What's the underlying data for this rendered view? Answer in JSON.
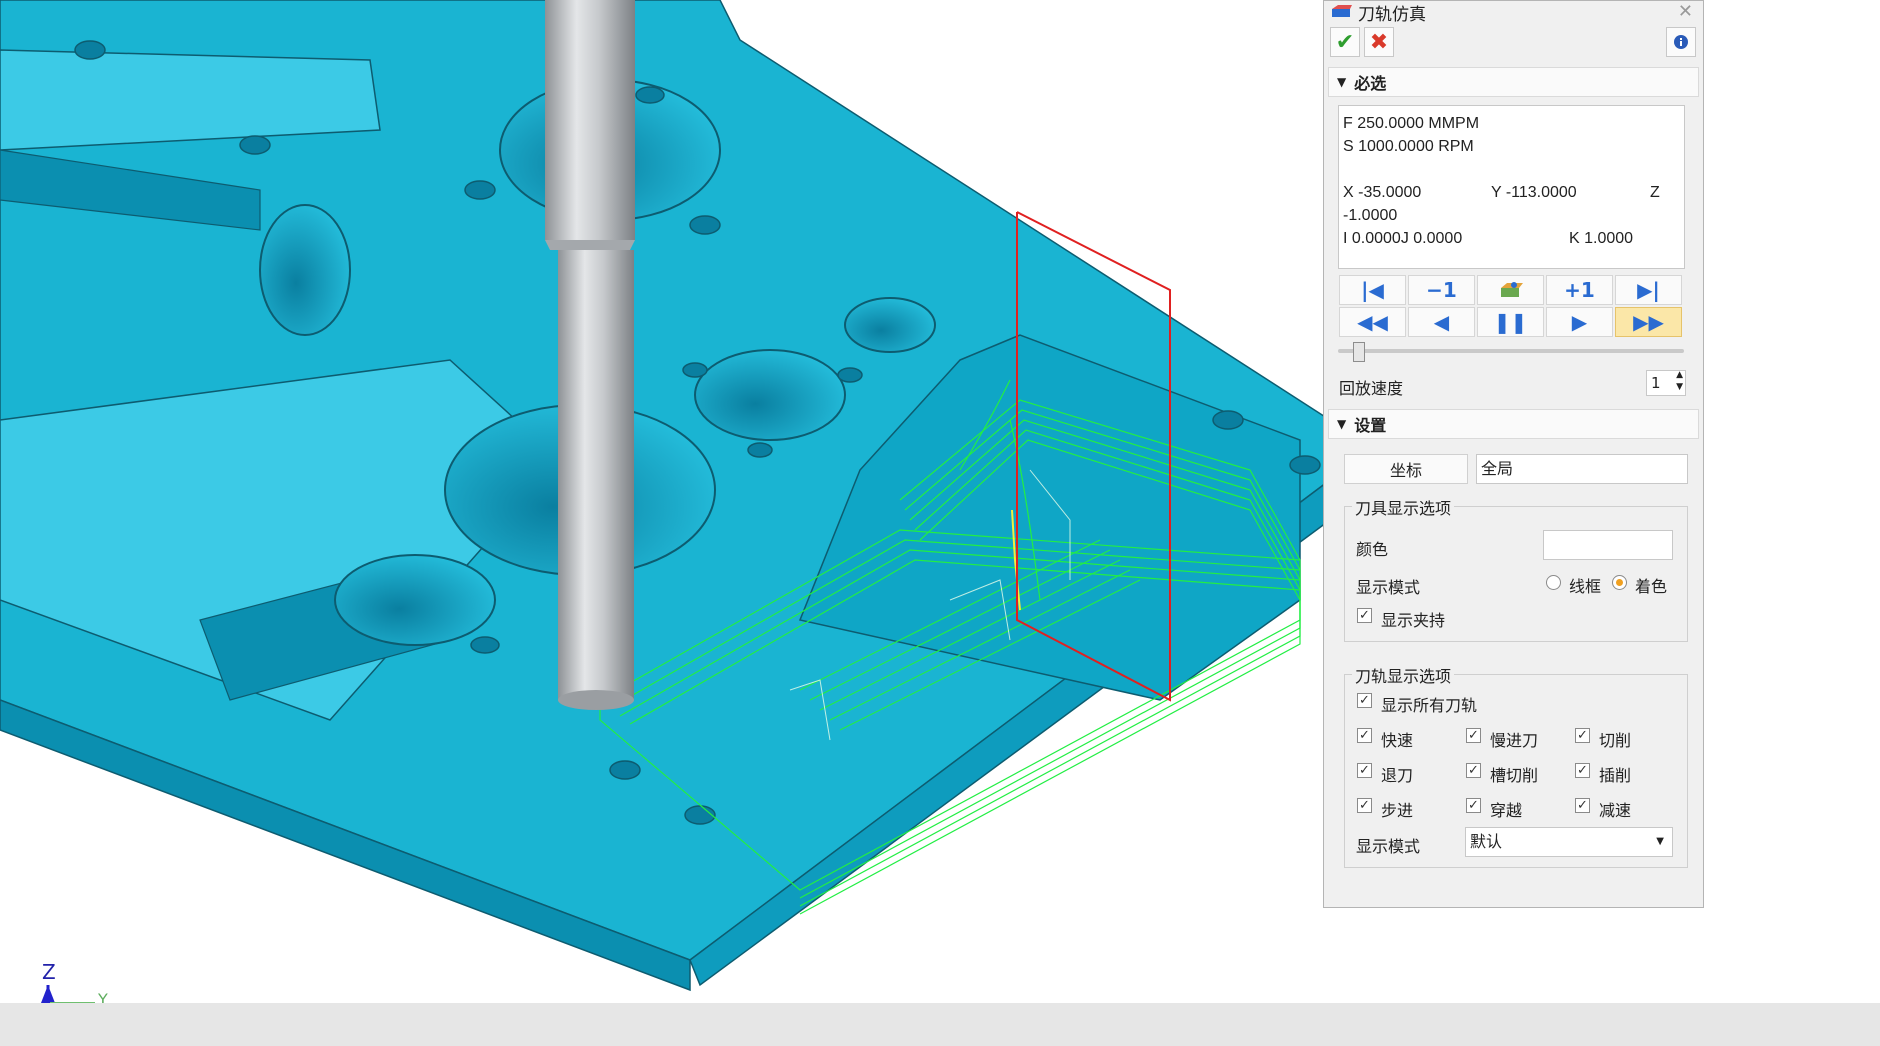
{
  "window": {
    "title": "刀轨仿真",
    "icon": "toolpath-sim-icon",
    "close_icon": "close-icon"
  },
  "actions": {
    "ok_icon": "check-icon",
    "cancel_icon": "x-icon",
    "info_icon": "info-icon",
    "ok_color": "#2e9d2e",
    "cancel_color": "#d93a2b"
  },
  "required_section": {
    "title": "必选",
    "readout": {
      "f": "F  250.0000 MMPM",
      "s": "S 1000.0000 RPM",
      "x": "X  -35.0000",
      "y": "Y -113.0000",
      "z_label": "Z",
      "z_value": "-1.0000",
      "i": "I    0.0000J    0.0000",
      "k": "K    1.0000"
    },
    "toolbar_row1": [
      {
        "name": "go-to-start",
        "label": "|◀"
      },
      {
        "name": "step-back",
        "label": "−1"
      },
      {
        "name": "show-material",
        "label": ""
      },
      {
        "name": "step-forward",
        "label": "+1"
      },
      {
        "name": "go-to-end",
        "label": "▶|"
      }
    ],
    "toolbar_row2": [
      {
        "name": "fast-rewind",
        "label": "◀◀"
      },
      {
        "name": "play-back",
        "label": "◀"
      },
      {
        "name": "pause",
        "label": "❚❚"
      },
      {
        "name": "play-forward",
        "label": "▶"
      },
      {
        "name": "fast-forward",
        "label": "▶▶"
      }
    ],
    "playback_speed_label": "回放速度",
    "playback_speed_value": "1",
    "slider_level": 0.06
  },
  "settings_section": {
    "title": "设置",
    "coord_button": "坐标",
    "coord_value": "全局",
    "tool_display": {
      "group_title": "刀具显示选项",
      "color_label": "颜色",
      "display_mode_label": "显示模式",
      "mode_wireframe": "线框",
      "mode_shaded": "着色",
      "selected_mode": "着色",
      "show_fixture": "显示夹持",
      "show_fixture_checked": true
    },
    "toolpath_display": {
      "group_title": "刀轨显示选项",
      "show_all": "显示所有刀轨",
      "options": [
        [
          "快速",
          "慢进刀",
          "切削"
        ],
        [
          "退刀",
          "槽切削",
          "插削"
        ],
        [
          "步进",
          "穿越",
          "减速"
        ]
      ],
      "display_mode_label": "显示模式",
      "display_mode_value": "默认"
    }
  },
  "axes": {
    "z": "Z",
    "y": "Y"
  },
  "colors": {
    "part": "#1ab4d2",
    "part_light": "#3ccae6",
    "part_dark": "#0b8fb0",
    "toolpath": "#22ee44",
    "boundary": "#e02020",
    "tool": "#b8bcc0"
  }
}
